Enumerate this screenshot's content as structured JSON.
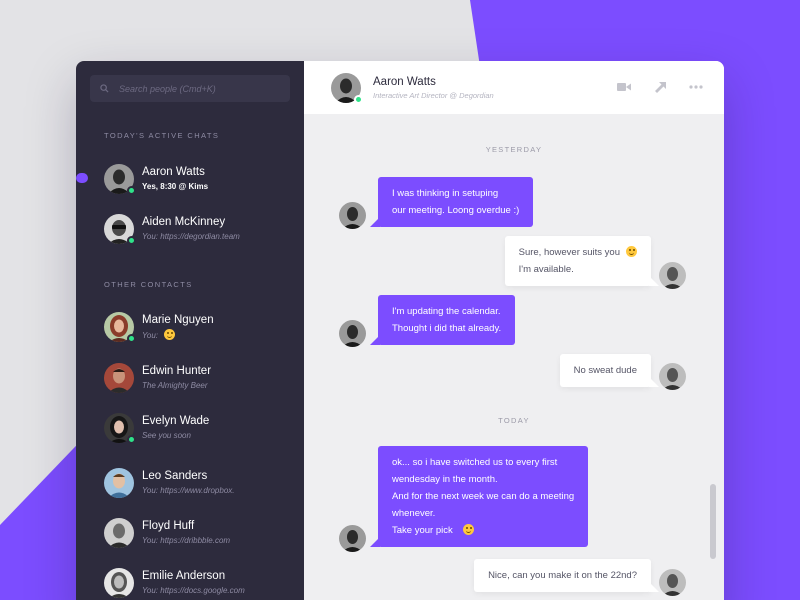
{
  "colors": {
    "accent": "#7c4dff",
    "sidebar_bg": "#2d2b3d",
    "online": "#2fe38a",
    "page_bg": "#e3e3e6"
  },
  "search": {
    "placeholder": "Search people (Cmd+K)"
  },
  "sections": {
    "active_title": "TODAY'S ACTIVE CHATS",
    "other_title": "OTHER CONTACTS"
  },
  "active_chats": [
    {
      "name": "Aaron Watts",
      "sub": "Yes, 8:30 @ Kims",
      "online": true,
      "bold_sub": true,
      "avatar_icon": "avatar-aaron"
    },
    {
      "name": "Aiden McKinney",
      "sub": "You: https://degordian.team",
      "online": true,
      "bold_sub": false,
      "avatar_icon": "avatar-aiden"
    }
  ],
  "other_contacts": [
    {
      "name": "Marie Nguyen",
      "sub": "You:",
      "emoji": "wink-emoji",
      "online": true
    },
    {
      "name": "Edwin Hunter",
      "sub": "The Almighty Beer",
      "online": false
    },
    {
      "name": "Evelyn Wade",
      "sub": "See you soon",
      "online": true
    },
    {
      "name": "Leo Sanders",
      "sub": "You: https://www.dropbox.",
      "online": false
    },
    {
      "name": "Floyd Huff",
      "sub": "You: https://dribbble.com",
      "online": false
    },
    {
      "name": "Emilie Anderson",
      "sub": "You: https://docs.google.com",
      "online": false
    }
  ],
  "header": {
    "name": "Aaron Watts",
    "subtitle": "Interactive Art Director @ Degordian",
    "icons": [
      "video-camera-icon",
      "expand-arrow-icon",
      "more-dots-icon"
    ]
  },
  "conversation": {
    "yesterday_label": "YESTERDAY",
    "today_label": "TODAY",
    "messages": [
      {
        "direction": "in",
        "lines": [
          "I was thinking in setuping",
          "our meeting. Loong overdue :)"
        ]
      },
      {
        "direction": "out",
        "lines": [
          "Sure, however suits you",
          "I'm available."
        ],
        "emoji_line": 0,
        "emoji": "wink-emoji"
      },
      {
        "direction": "in",
        "lines": [
          "I'm updating the calendar.",
          "Thought i did that already."
        ]
      },
      {
        "direction": "out",
        "lines": [
          "No sweat dude"
        ]
      },
      {
        "direction": "in",
        "lines": [
          "ok... so i have switched us to every first",
          "wendesday in the month.",
          "And for the next week we can do a meeting",
          "whenever.",
          "Take your pick"
        ],
        "emoji_line": 4,
        "emoji": "smile-emoji"
      },
      {
        "direction": "out",
        "lines": [
          "Nice, can you make it on the 22nd?"
        ]
      }
    ]
  }
}
